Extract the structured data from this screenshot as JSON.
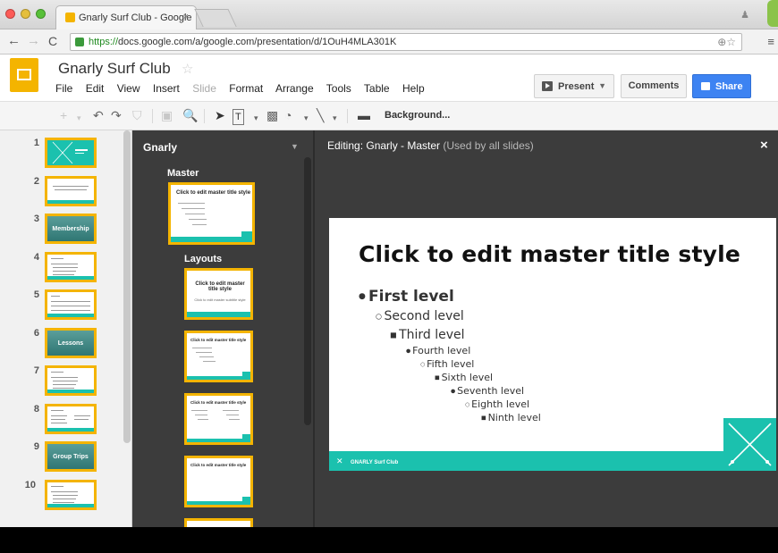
{
  "browser": {
    "tab_title": "Gnarly Surf Club - Google",
    "tab_close": "×",
    "url_scheme": "https://",
    "url_rest": "docs.google.com/a/google.com/presentation/d/1OuH4MLA301K",
    "traffic_colors": [
      "#fc5b57",
      "#e5bf3c",
      "#57c038"
    ]
  },
  "header": {
    "doc_title": "Gnarly Surf Club",
    "menus": [
      {
        "label": "File"
      },
      {
        "label": "Edit"
      },
      {
        "label": "View"
      },
      {
        "label": "Insert"
      },
      {
        "label": "Slide",
        "disabled": true
      },
      {
        "label": "Format"
      },
      {
        "label": "Arrange"
      },
      {
        "label": "Tools"
      },
      {
        "label": "Table"
      },
      {
        "label": "Help"
      }
    ],
    "present_label": "Present",
    "comments_label": "Comments",
    "share_label": "Share",
    "accent": "#f4b400",
    "share_color": "#3d83f2"
  },
  "toolbar": {
    "background_label": "Background..."
  },
  "filmstrip": {
    "slides": [
      {
        "num": "1",
        "style": "teal-title"
      },
      {
        "num": "2",
        "style": "text"
      },
      {
        "num": "3",
        "style": "photo",
        "label": "Membership"
      },
      {
        "num": "4",
        "style": "list"
      },
      {
        "num": "5",
        "style": "table"
      },
      {
        "num": "6",
        "style": "photo",
        "label": "Lessons"
      },
      {
        "num": "7",
        "style": "list"
      },
      {
        "num": "8",
        "style": "two-col"
      },
      {
        "num": "9",
        "style": "photo",
        "label": "Group Trips"
      },
      {
        "num": "10",
        "style": "list"
      }
    ]
  },
  "master_panel": {
    "theme_name": "Gnarly",
    "master_label": "Master",
    "layouts_label": "Layouts",
    "master_thumb_title": "Click to edit master title style",
    "layouts": [
      {
        "title": "Click to edit master title style",
        "subtitle": "Click to edit master subtitle style",
        "kind": "title"
      },
      {
        "title": "Click to edit master title style",
        "kind": "body"
      },
      {
        "title": "Click to edit master title style",
        "kind": "two-col"
      },
      {
        "title": "Click to edit master title style",
        "kind": "title-only"
      }
    ]
  },
  "editor": {
    "editing_prefix": "Editing: Gnarly - Master",
    "editing_suffix": "(Used by all slides)",
    "close": "×",
    "slide": {
      "title": "Click to edit master title style",
      "levels": [
        "First level",
        "Second level",
        "Third level",
        "Fourth level",
        "Fifth level",
        "Sixth level",
        "Seventh level",
        "Eighth level",
        "Ninth level"
      ],
      "footer": "GNARLY Surf Club",
      "accent": "#1bc1ae"
    }
  }
}
